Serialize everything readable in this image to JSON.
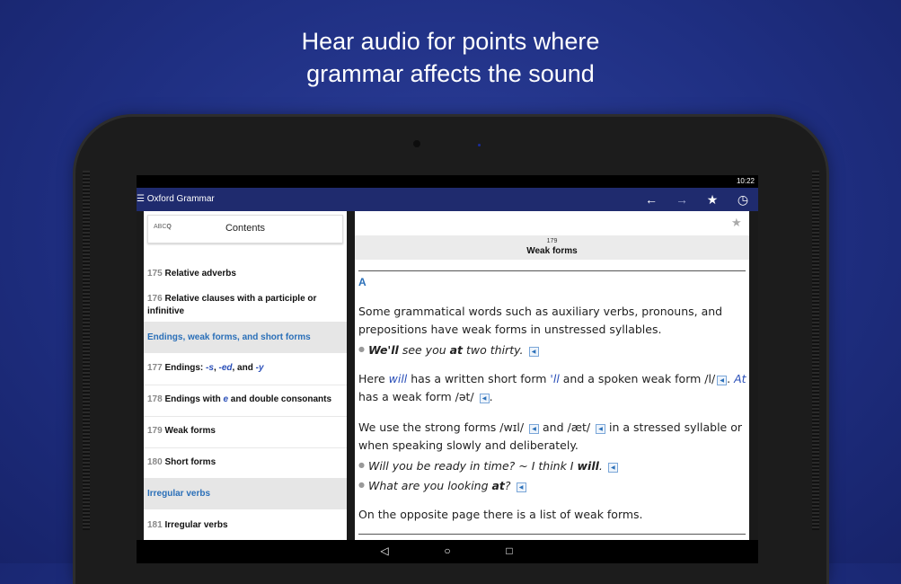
{
  "headline": {
    "line1": "Hear audio for points where",
    "line2": "grammar affects the sound"
  },
  "statusbar": {
    "time": "10:22"
  },
  "appbar": {
    "menu_icon": "☰",
    "title": "Oxford Grammar",
    "back_icon": "←",
    "forward_icon": "→",
    "star_icon": "★",
    "history_icon": "◷"
  },
  "sidebar": {
    "search_hint": "ABC",
    "search_icon": "Q",
    "contents_label": "Contents",
    "items": [
      {
        "num": "175",
        "label": "Relative adverbs"
      },
      {
        "num": "176",
        "label": "Relative clauses with a participle or infinitive"
      },
      {
        "section": "Endings, weak forms, and short forms"
      },
      {
        "num": "177",
        "label": "Endings: -s, -ed, and -y"
      },
      {
        "num": "178",
        "label": "Endings with e and double consonants"
      },
      {
        "num": "179",
        "label": "Weak forms"
      },
      {
        "num": "180",
        "label": "Short forms"
      },
      {
        "section": "Irregular verbs"
      },
      {
        "num": "181",
        "label": "Irregular verbs"
      }
    ]
  },
  "page": {
    "number": "179",
    "title": "Weak forms",
    "section_letter": "A",
    "p1": "Some grammatical words such as auxiliary verbs, pronouns, and prepositions have weak forms in unstressed syllables.",
    "ex1": "We'll see you at two thirty.",
    "p2": "Here will has a written short form 'll and a spoken weak form /l/. At has a weak form /ət/.",
    "p3": "We use the strong forms /wɪl/ and /æt/ in a stressed syllable or when speaking slowly and deliberately.",
    "ex2": "Will you be ready in time? ~ I think I will.",
    "ex3": "What are you looking at?",
    "p4": "On the opposite page there is a list of weak forms."
  },
  "navbar": {
    "back_icon": "◁",
    "home_icon": "○",
    "recents_icon": "□"
  },
  "colors": {
    "background": "#1f2f82",
    "appbar": "#1f2b6e",
    "link": "#2a6fb8",
    "arrow": "#e8201f"
  }
}
